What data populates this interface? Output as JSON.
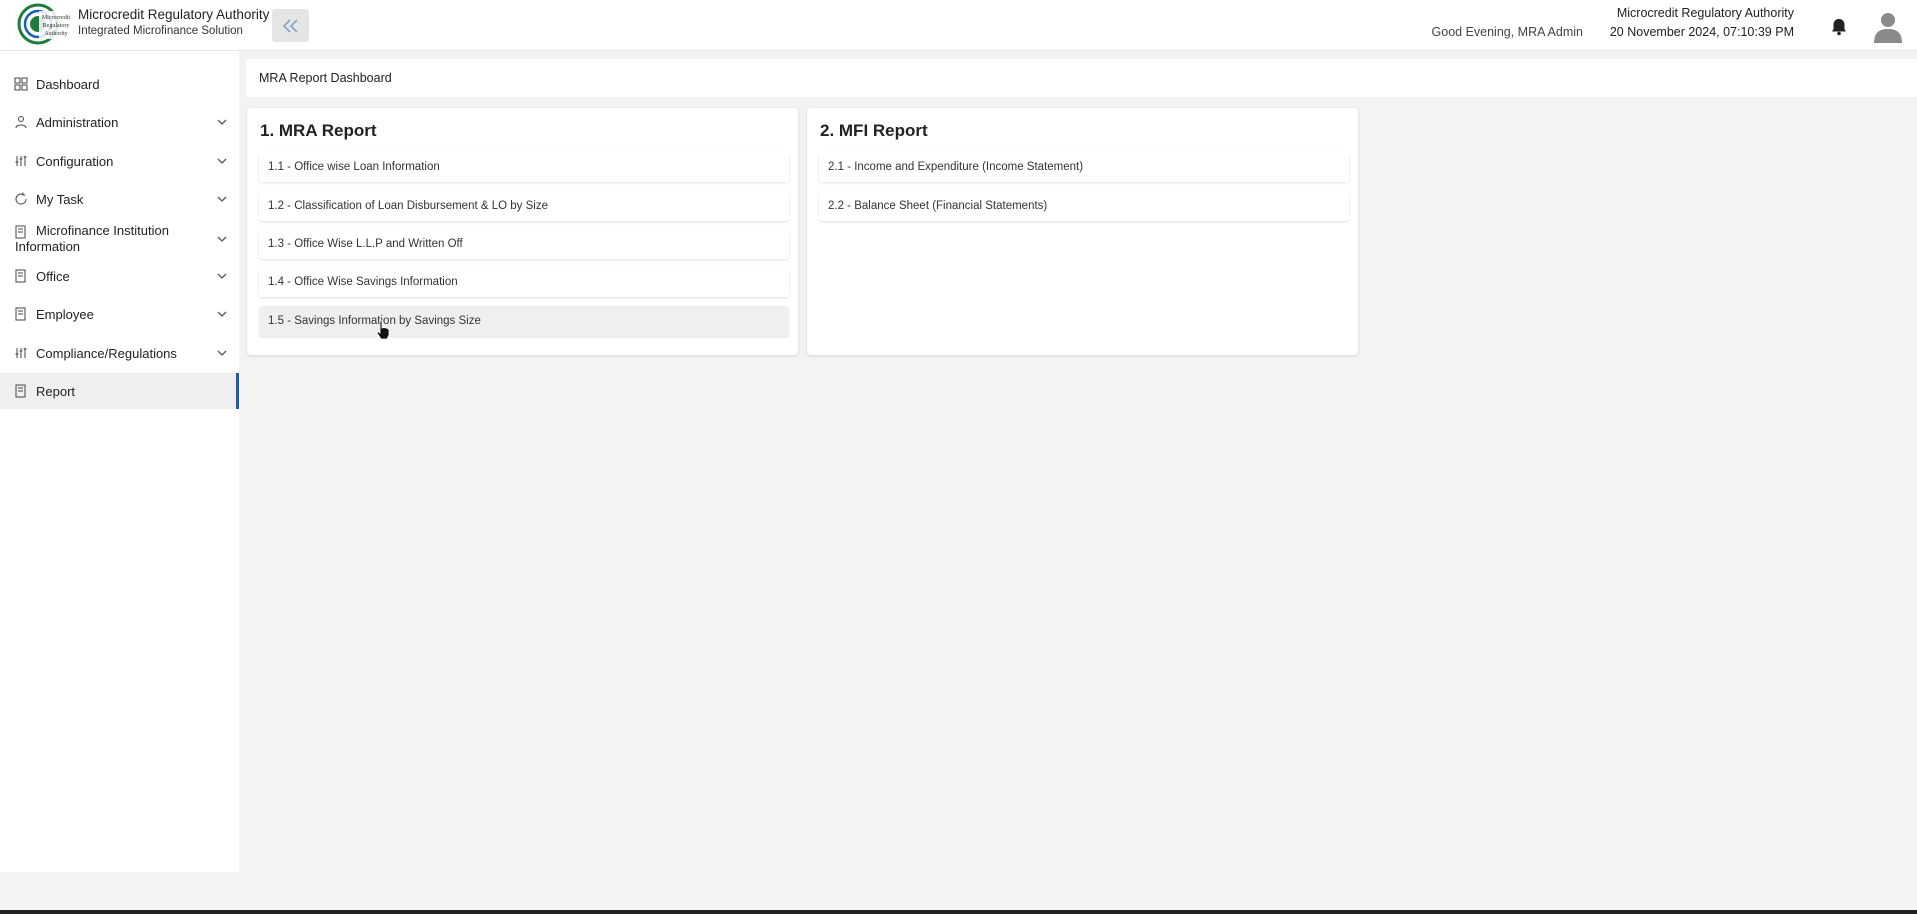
{
  "header": {
    "logo_text": "Microcredit Regulatory Authority",
    "brand_title": "Microcredit Regulatory Authority",
    "brand_subtitle": "Integrated Microfinance Solution",
    "greeting": "Good Evening, MRA Admin",
    "org_name": "Microcredit Regulatory Authority",
    "datetime": "20 November 2024, 07:10:39 PM",
    "collapse_icon": "double-chevron-left-icon",
    "notification_icon": "bell-icon",
    "avatar_icon": "user-avatar-icon"
  },
  "sidebar": {
    "items": [
      {
        "label": "Dashboard",
        "icon": "grid-icon",
        "expandable": false
      },
      {
        "label": "Administration",
        "icon": "users-icon",
        "expandable": true
      },
      {
        "label": "Configuration",
        "icon": "sliders-icon",
        "expandable": true
      },
      {
        "label": "My Task",
        "icon": "refresh-icon",
        "expandable": true
      },
      {
        "label": "Microfinance Institution Information",
        "icon": "document-icon",
        "expandable": true
      },
      {
        "label": "Office",
        "icon": "document-icon",
        "expandable": true
      },
      {
        "label": "Employee",
        "icon": "document-icon",
        "expandable": true
      },
      {
        "label": "Compliance/Regulations",
        "icon": "sliders-icon",
        "expandable": true
      },
      {
        "label": "Report",
        "icon": "document-icon",
        "expandable": false,
        "active": true
      }
    ]
  },
  "main": {
    "breadcrumb": "MRA Report Dashboard",
    "cards": [
      {
        "title": "1. MRA Report",
        "items": [
          "1.1 - Office wise Loan Information",
          "1.2 - Classification of Loan Disbursement & LO by Size",
          "1.3 - Office Wise L.L.P and Written Off",
          "1.4 - Office Wise Savings Information",
          "1.5 - Savings Information by Savings Size"
        ]
      },
      {
        "title": "2. MFI Report",
        "items": [
          "2.1 - Income and Expenditure (Income Statement)",
          "2.2 - Balance Sheet (Financial Statements)"
        ]
      }
    ]
  },
  "colors": {
    "accent": "#1a5fb4",
    "background": "#f3f3f3",
    "card": "#ffffff"
  }
}
